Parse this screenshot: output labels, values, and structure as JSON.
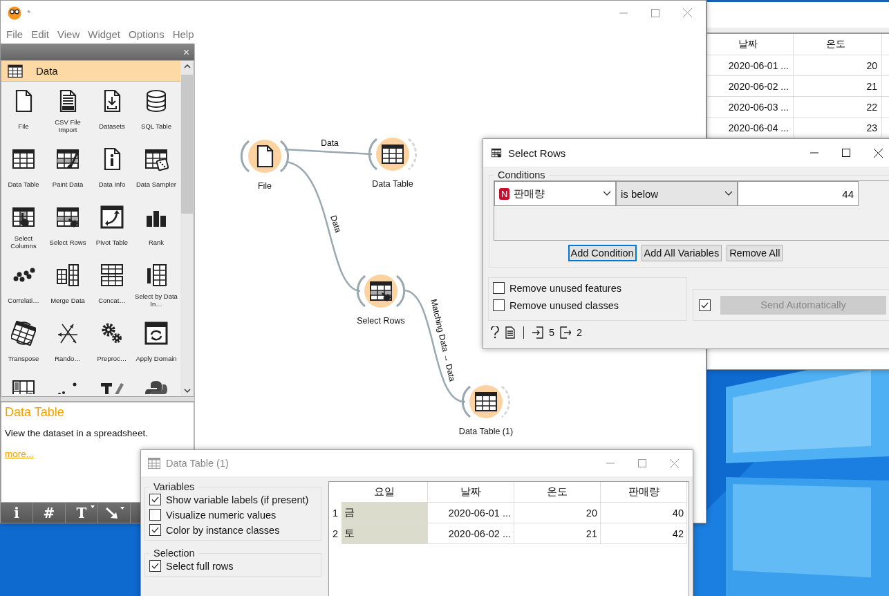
{
  "main_window": {
    "title": "*",
    "menu": [
      "File",
      "Edit",
      "View",
      "Widget",
      "Options",
      "Help"
    ]
  },
  "toolbox": {
    "category": "Data",
    "widgets": [
      {
        "label": "File"
      },
      {
        "label": "CSV File Import"
      },
      {
        "label": "Datasets"
      },
      {
        "label": "SQL Table"
      },
      {
        "label": "Data Table"
      },
      {
        "label": "Paint Data"
      },
      {
        "label": "Data Info"
      },
      {
        "label": "Data Sampler"
      },
      {
        "label": "Select Columns"
      },
      {
        "label": "Select Rows"
      },
      {
        "label": "Pivot Table"
      },
      {
        "label": "Rank"
      },
      {
        "label": "Correlati…"
      },
      {
        "label": "Merge Data"
      },
      {
        "label": "Concat…"
      },
      {
        "label": "Select by Data In…"
      },
      {
        "label": "Transpose"
      },
      {
        "label": "Rando…"
      },
      {
        "label": "Preproc…"
      },
      {
        "label": "Apply Domain"
      }
    ],
    "description": {
      "title": "Data Table",
      "text": "View the dataset in a spreadsheet.",
      "link": "more..."
    },
    "toolbar": [
      {
        "glyph": "i",
        "menu": false
      },
      {
        "glyph": "#",
        "menu": false
      },
      {
        "glyph": "T",
        "menu": true
      }
    ]
  },
  "canvas": {
    "nodes": [
      {
        "label": "File"
      },
      {
        "label": "Data Table"
      },
      {
        "label": "Select Rows"
      },
      {
        "label": "Data Table (1)"
      }
    ],
    "links": [
      {
        "label": "Data"
      },
      {
        "label": "Data"
      },
      {
        "label": "Matching Data → Data"
      }
    ]
  },
  "background_window": {
    "columns": [
      "날짜",
      "온도"
    ],
    "rows": [
      [
        "2020-06-01 ...",
        "20"
      ],
      [
        "2020-06-02 ...",
        "21"
      ],
      [
        "2020-06-03 ...",
        "22"
      ],
      [
        "2020-06-04 ...",
        "23"
      ]
    ]
  },
  "select_rows": {
    "title": "Select Rows",
    "conditions_label": "Conditions",
    "condition": {
      "badge": "N",
      "variable": "판매량",
      "operator": "is below",
      "value": "44"
    },
    "buttons": [
      {
        "label": "Add Condition",
        "focused": true
      },
      {
        "label": "Add All Variables",
        "focused": false
      },
      {
        "label": "Remove All",
        "focused": false
      }
    ],
    "options": [
      {
        "label": "Remove unused features",
        "checked": false
      },
      {
        "label": "Remove unused classes",
        "checked": false
      }
    ],
    "send_automatically": {
      "checked": true,
      "label": "Send Automatically",
      "disabled": true
    },
    "status": {
      "inputs": "5",
      "outputs": "2"
    }
  },
  "data_table": {
    "title": "Data Table (1)",
    "variables_label": "Variables",
    "variables": [
      {
        "label": "Show variable labels (if present)",
        "checked": true
      },
      {
        "label": "Visualize numeric values",
        "checked": false
      },
      {
        "label": "Color by instance classes",
        "checked": true
      }
    ],
    "selection_label": "Selection",
    "selection": [
      {
        "label": "Select full rows",
        "checked": true
      }
    ],
    "columns": [
      "요일",
      "날짜",
      "온도",
      "판매량"
    ],
    "rows": [
      {
        "index": "1",
        "cells": [
          "금",
          "2020-06-01 ...",
          "20",
          "40"
        ]
      },
      {
        "index": "2",
        "cells": [
          "토",
          "2020-06-02 ...",
          "21",
          "42"
        ]
      }
    ]
  }
}
